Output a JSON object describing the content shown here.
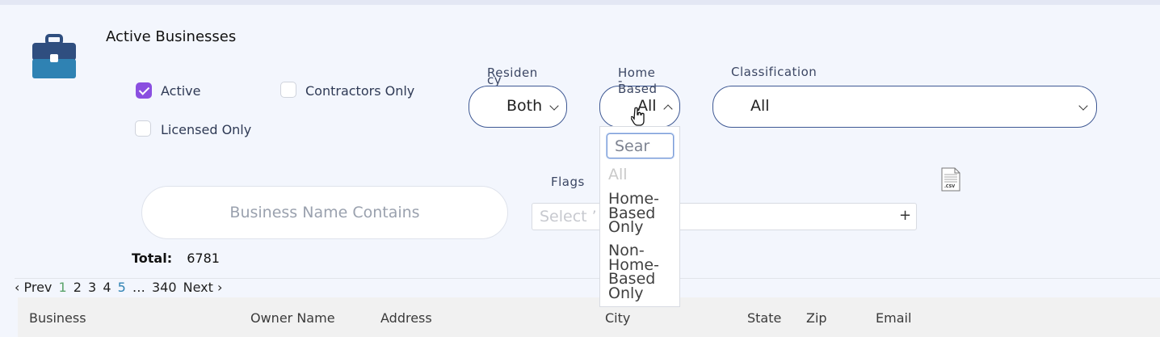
{
  "header": {
    "title": "Active Businesses"
  },
  "colors": {
    "accent": "#8a4fe0",
    "icon_dark": "#2f4e7f",
    "icon_light": "#2f82b3",
    "pill_border": "#3e5893"
  },
  "filters": {
    "active_label": "Active",
    "active_checked": true,
    "contractors_label": "Contractors Only",
    "contractors_checked": false,
    "licensed_label": "Licensed Only",
    "licensed_checked": false,
    "residency": {
      "label_line1": "Residen",
      "label_line2": "cy",
      "value": "Both"
    },
    "home_based": {
      "label_line1": "Home",
      "label_line2": "-",
      "label_line3": "Based",
      "value": "All"
    },
    "classification": {
      "label": "Classification",
      "value": "All"
    },
    "business_name": {
      "placeholder": "Business Name Contains"
    },
    "flags": {
      "label": "Flags",
      "placeholder": "Select ’",
      "add": "+"
    }
  },
  "home_based_dropdown": {
    "search_placeholder": "Sear",
    "options": [
      {
        "lines": [
          "All"
        ],
        "disabled": true
      },
      {
        "lines": [
          "Home-",
          "Based",
          "Only"
        ],
        "disabled": false
      },
      {
        "lines": [
          "Non-",
          "Home-",
          "Based",
          "Only"
        ],
        "disabled": false
      }
    ]
  },
  "export": {
    "icon": "csv-file-icon",
    "label": ".CSV"
  },
  "summary": {
    "total_label": "Total:",
    "total_value": "6781"
  },
  "pagination": {
    "prev": "‹ Prev",
    "pages": [
      "1",
      "2",
      "3",
      "4",
      "5",
      "…",
      "340"
    ],
    "current": "1",
    "next": "Next ›"
  },
  "table": {
    "columns": [
      "Business",
      "Owner Name",
      "Address",
      "City",
      "State",
      "Zip",
      "Email"
    ]
  },
  "icons": {
    "header_icon": "briefcase-icon",
    "cursor": "hand-cursor-icon"
  }
}
